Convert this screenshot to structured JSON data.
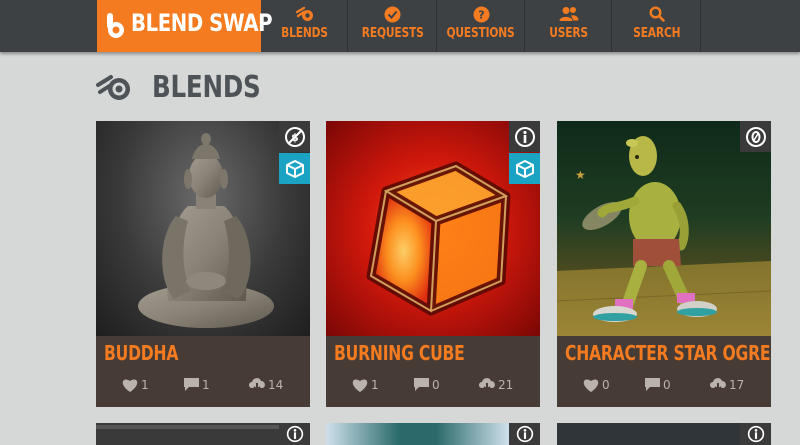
{
  "header": {
    "logo_text": "BLEND SWAP",
    "nav": [
      {
        "label": "BLENDS",
        "icon": "blender-icon"
      },
      {
        "label": "REQUESTS",
        "icon": "check-circle-icon"
      },
      {
        "label": "QUESTIONS",
        "icon": "question-circle-icon"
      },
      {
        "label": "USERS",
        "icon": "users-icon"
      },
      {
        "label": "SEARCH",
        "icon": "search-icon"
      }
    ]
  },
  "page": {
    "title": "BLENDS"
  },
  "cards": [
    {
      "title": "BUDDHA",
      "likes": "1",
      "comments": "1",
      "downloads": "14",
      "badges": [
        "no-copyright-icon",
        "cube-icon"
      ]
    },
    {
      "title": "BURNING CUBE",
      "likes": "1",
      "comments": "0",
      "downloads": "21",
      "badges": [
        "info-icon",
        "cube-icon"
      ]
    },
    {
      "title": "CHARACTER STAR OGRE",
      "likes": "0",
      "comments": "0",
      "downloads": "17",
      "badges": [
        "zero-icon"
      ]
    }
  ],
  "colors": {
    "accent": "#f47b20",
    "nav_bg": "#3d4144",
    "card_bg": "#463b35",
    "badge_blue": "#1aa3c2",
    "page_bg": "#d5d8d7"
  }
}
